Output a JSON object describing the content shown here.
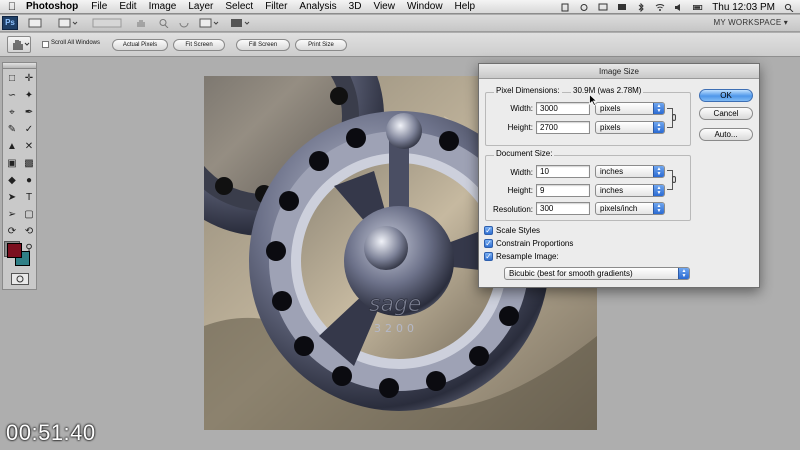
{
  "menubar": {
    "app_name": "Photoshop",
    "items": [
      "File",
      "Edit",
      "Image",
      "Layer",
      "Select",
      "Filter",
      "Analysis",
      "3D",
      "View",
      "Window",
      "Help"
    ],
    "clock": "Thu 12:03 PM"
  },
  "appbar": {
    "logo": "Ps",
    "workspace": "MY WORKSPACE ▾"
  },
  "options_bar": {
    "scroll_all_label": "Scroll All Windows",
    "buttons": [
      "Actual Pixels",
      "Fit Screen",
      "Fill Screen",
      "Print Size"
    ]
  },
  "dialog": {
    "title": "Image Size",
    "pixel_dimensions": {
      "title": "Pixel Dimensions:",
      "size": "30.9M (was 2.78M)",
      "width_label": "Width:",
      "width_value": "3000",
      "width_unit": "pixels",
      "height_label": "Height:",
      "height_value": "2700",
      "height_unit": "pixels"
    },
    "document_size": {
      "title": "Document Size:",
      "width_label": "Width:",
      "width_value": "10",
      "width_unit": "inches",
      "height_label": "Height:",
      "height_value": "9",
      "height_unit": "inches",
      "resolution_label": "Resolution:",
      "resolution_value": "300",
      "resolution_unit": "pixels/inch"
    },
    "options": {
      "scale_styles": "Scale Styles",
      "constrain_proportions": "Constrain Proportions",
      "resample_image": "Resample Image:",
      "resample_method": "Bicubic (best for smooth gradients)"
    },
    "buttons": {
      "ok": "OK",
      "cancel": "Cancel",
      "auto": "Auto..."
    }
  },
  "image": {
    "brand_text": "sage",
    "model_text": "3200"
  },
  "colors": {
    "foreground": "#7b0f1f",
    "background": "#2f7f86",
    "accent": "#4f97ea"
  },
  "video_timestamp": "00:51:40"
}
